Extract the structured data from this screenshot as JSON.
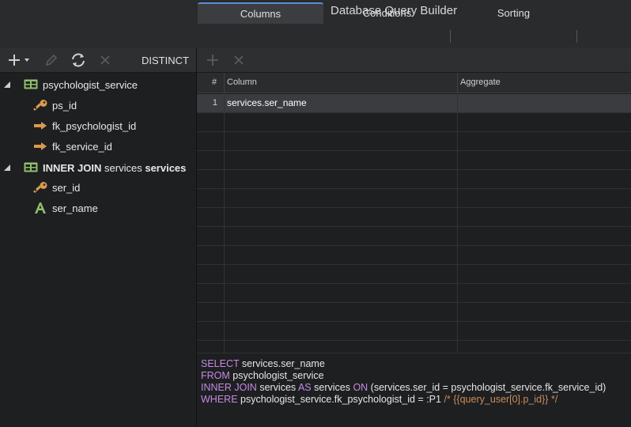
{
  "window": {
    "title": "Database Query Builder"
  },
  "tabs": [
    {
      "label": "Columns",
      "active": true
    },
    {
      "label": "Conditions",
      "active": false
    },
    {
      "label": "Sorting",
      "active": false
    }
  ],
  "toolbar": {
    "add_icon": "plus-icon",
    "distinct_label": "DISTINCT"
  },
  "tree": {
    "tables": [
      {
        "name": "psychologist_service",
        "columns": [
          {
            "name": "ps_id",
            "icon": "key-icon"
          },
          {
            "name": "fk_psychologist_id",
            "icon": "arrow-right-icon"
          },
          {
            "name": "fk_service_id",
            "icon": "arrow-right-icon"
          }
        ]
      },
      {
        "join_prefix": "INNER JOIN",
        "name": "services",
        "alias": "services",
        "columns": [
          {
            "name": "ser_id",
            "icon": "key-icon"
          },
          {
            "name": "ser_name",
            "icon": "text-icon"
          }
        ]
      }
    ]
  },
  "grid": {
    "headers": {
      "num": "#",
      "column": "Column",
      "aggregate": "Aggregate"
    },
    "rows": [
      {
        "num": "1",
        "column": "services.ser_name",
        "aggregate": ""
      }
    ]
  },
  "sql": {
    "line1": {
      "kw": "SELECT",
      "text": " services.ser_name"
    },
    "line2": {
      "kw": "FROM",
      "text": " psychologist_service"
    },
    "line3": {
      "kw1": "INNER JOIN",
      "text1": " services ",
      "kw2": "AS",
      "text2": " services ",
      "kw3": "ON",
      "text3": " (services.ser_id = psychologist_service.fk_service_id)"
    },
    "line4": {
      "kw": "WHERE",
      "text": " psychologist_service.fk_psychologist_id = :P1 ",
      "comment": "/* {{query_user[0].p_id}} */"
    }
  },
  "colors": {
    "keyword": "#c48be3",
    "comment": "#c98d5b",
    "tab_accent": "#5b8fd6",
    "key_icon": "#d99a4e",
    "table_icon": "#8fbf6a"
  }
}
